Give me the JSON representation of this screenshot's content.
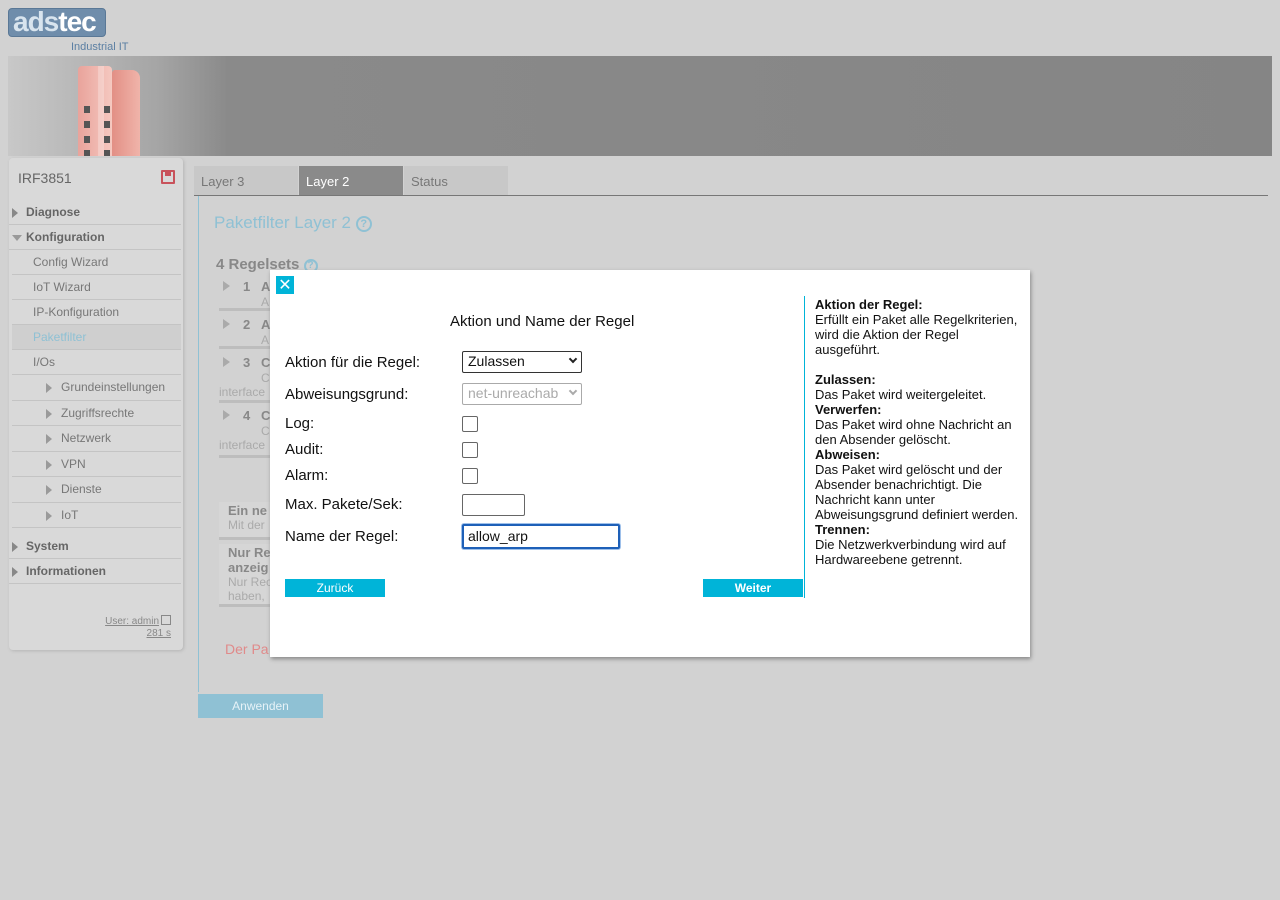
{
  "header": {
    "logo_text_a": "ads",
    "logo_text_b": "tec",
    "logo_sub": "Industrial IT"
  },
  "sidebar": {
    "device_name": "IRF3851",
    "items": [
      {
        "label": "Diagnose"
      },
      {
        "label": "Konfiguration"
      },
      {
        "label": "Config Wizard"
      },
      {
        "label": "IoT Wizard"
      },
      {
        "label": "IP-Konfiguration"
      },
      {
        "label": "Paketfilter"
      },
      {
        "label": "I/Os"
      },
      {
        "label": "Grundeinstellungen"
      },
      {
        "label": "Zugriffsrechte"
      },
      {
        "label": "Netzwerk"
      },
      {
        "label": "VPN"
      },
      {
        "label": "Dienste"
      },
      {
        "label": "IoT"
      },
      {
        "label": "System"
      },
      {
        "label": "Informationen"
      }
    ],
    "user": "User: admin",
    "time": "281 s"
  },
  "tabs": [
    {
      "label": "Layer 3"
    },
    {
      "label": "Layer 2"
    },
    {
      "label": "Status"
    }
  ],
  "main": {
    "title": "Paketfilter Layer 2",
    "help_glyph": "?",
    "sets_title": "4 Regelsets",
    "rulesets": [
      {
        "num": "1",
        "title": "A",
        "sub": "A",
        "iface": ""
      },
      {
        "num": "2",
        "title": "A",
        "sub": "A",
        "iface": ""
      },
      {
        "num": "3",
        "title": "C",
        "sub": "C",
        "iface": "interface"
      },
      {
        "num": "4",
        "title": "C",
        "sub": "C",
        "iface": "interface"
      }
    ],
    "info1": {
      "bold": "Ein ne",
      "normal": "Mit der"
    },
    "info2": {
      "bold1": "Nur Re",
      "bold2": "anzeig",
      "normal1": "Nur Rec",
      "normal2": "haben,"
    },
    "red_note": "Der Pa",
    "apply_label": "Anwenden"
  },
  "modal": {
    "close_glyph": "✕",
    "title": "Aktion und Name der Regel",
    "action_label": "Aktion für die Regel:",
    "action_value": "Zulassen",
    "reject_label": "Abweisungsgrund:",
    "reject_value": "net-unreachab",
    "log_label": "Log:",
    "audit_label": "Audit:",
    "alarm_label": "Alarm:",
    "maxpps_label": "Max. Pakete/Sek:",
    "maxpps_value": "",
    "name_label": "Name der Regel:",
    "name_value": "allow_arp",
    "back_label": "Zurück",
    "next_label": "Weiter",
    "help": {
      "h1": "Aktion der Regel:",
      "t1": "Erfüllt ein Paket alle Regelkriterien, wird die Aktion der Regel ausgeführt.",
      "h2": "Zulassen:",
      "t2": "Das Paket wird weitergeleitet.",
      "h3": "Verwerfen:",
      "t3": "Das Paket wird ohne Nachricht an den Absender gelöscht.",
      "h4": "Abweisen:",
      "t4": "Das Paket wird gelöscht und der Absender benachrichtigt. Die Nachricht kann unter Abweisungsgrund definiert werden.",
      "h5": "Trennen:",
      "t5": "Die Netzwerkverbindung wird auf Hardwareebene getrennt."
    }
  },
  "colors": {
    "accent": "#00b4d8",
    "muted_accent": "#8fc1d4",
    "focus": "#1e60b8"
  }
}
